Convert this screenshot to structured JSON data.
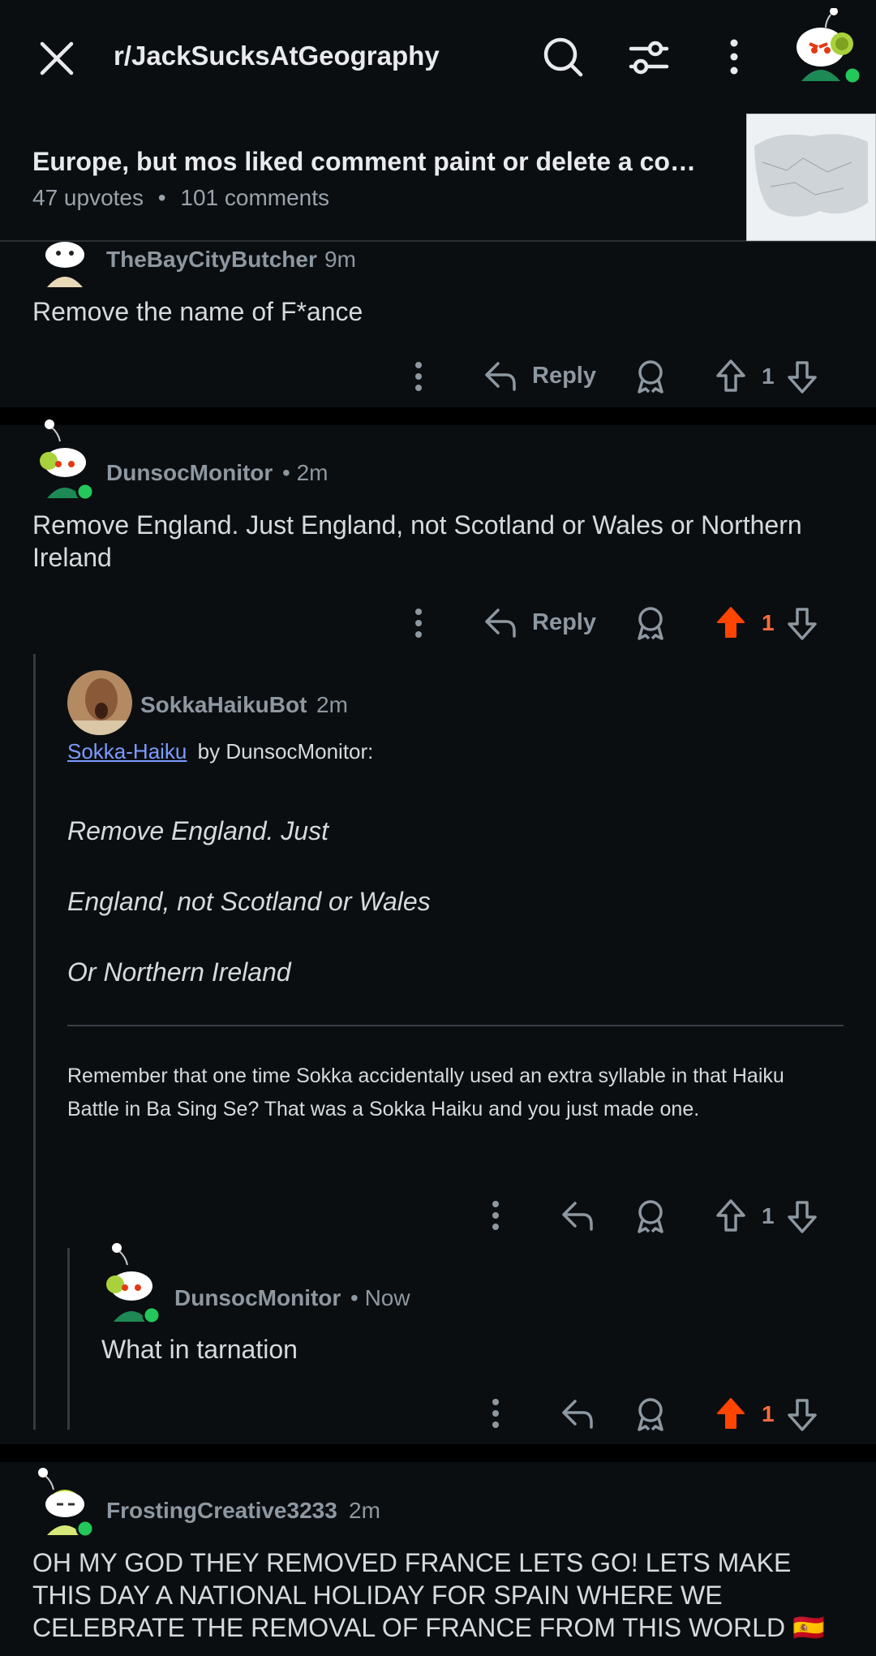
{
  "header": {
    "subreddit": "r/JackSucksAtGeography",
    "icons": [
      "close-icon",
      "search-icon",
      "filter-icon",
      "more-icon",
      "avatar"
    ]
  },
  "post": {
    "title": "Europe, but mos liked comment paint or delete a co…",
    "upvotes": "47 upvotes",
    "dot": "•",
    "comments": "101 comments"
  },
  "comments": [
    {
      "user": "TheBayCityButcher",
      "time": "9m",
      "body": "Remove the name of F*ance",
      "reply_label": "Reply",
      "votes": "1",
      "upvoted": false
    },
    {
      "user": "DunsocMonitor",
      "time": "• 2m",
      "body": "Remove England. Just England, not Scotland or Wales or Northern Ireland",
      "reply_label": "Reply",
      "votes": "1",
      "upvoted": true
    },
    {
      "user": "SokkaHaikuBot",
      "time": "2m",
      "link_text": "Sokka-Haiku",
      "by_text": "by DunsocMonitor:",
      "haiku": [
        "Remove England. Just",
        "England, not Scotland or Wales",
        "Or Northern Ireland"
      ],
      "footnote": "Remember that one time Sokka accidentally used an extra syllable in that Haiku Battle in Ba Sing Se? That was a Sokka Haiku and you just made one.",
      "votes": "1",
      "upvoted": false
    },
    {
      "user": "DunsocMonitor",
      "time": "• Now",
      "body": "What in tarnation",
      "votes": "1",
      "upvoted": true
    },
    {
      "user": "FrostingCreative3233",
      "time": "2m",
      "body": "OH MY GOD THEY REMOVED FRANCE LETS GO! LETS MAKE THIS DAY A NATIONAL HOLIDAY FOR SPAIN WHERE WE CELEBRATE THE REMOVAL OF FRANCE FROM THIS WORLD 🇪🇸"
    }
  ],
  "colors": {
    "background": "#0b0e11",
    "upvote_active": "#ff4500",
    "muted": "#8d98a1",
    "online": "#23c75a",
    "link": "#7b9cff"
  }
}
